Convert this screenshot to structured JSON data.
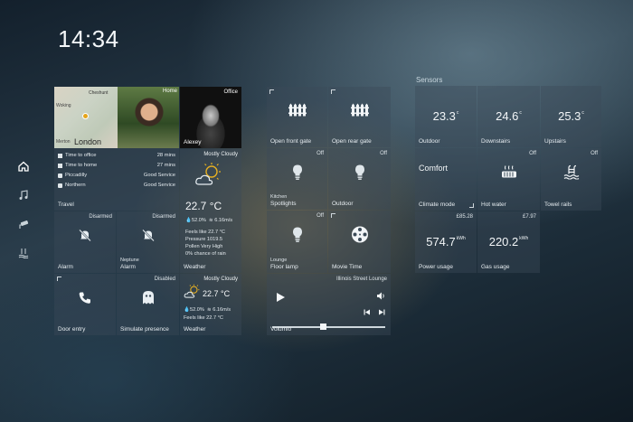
{
  "clock": "14:34",
  "nav": [
    "home-icon",
    "music-icon",
    "camera-icon",
    "water-icon"
  ],
  "travel": {
    "home_tag": "Home",
    "map_place": "London",
    "map_place2": "Cheshunt",
    "map_place3": "Merton",
    "map_place4": "Woking",
    "photo_tag": "Office",
    "photo_name": "Alexey",
    "rows": [
      {
        "label": "Time to office",
        "value": "28 mins"
      },
      {
        "label": "Time to home",
        "value": "27 mins"
      },
      {
        "label": "Piccadilly",
        "value": "Good Service"
      },
      {
        "label": "Northern",
        "value": "Good Service"
      }
    ],
    "label": "Travel"
  },
  "alarm1": {
    "state": "Disarmed",
    "label": "Alarm"
  },
  "alarm2": {
    "state": "Disarmed",
    "sub": "Neptune",
    "label": "Alarm"
  },
  "weather1": {
    "condition": "Mostly Cloudy",
    "temp": "22.7 °C",
    "humidity": "52.0%",
    "wind": "6.16m/s",
    "feels": "Feels like 22.7 °C",
    "pressure": "Pressure 1019.5",
    "pollen": "Pollen Very High",
    "rain": "0% chance of rain",
    "label": "Weather"
  },
  "door": {
    "label": "Door entry"
  },
  "presence": {
    "state": "Disabled",
    "label": "Simulate presence"
  },
  "weather2": {
    "condition": "Mostly Cloudy",
    "temp": "22.7 °C",
    "humidity": "52.0%",
    "wind": "6.16m/s",
    "feels": "Feels like 22.7 °C",
    "label": "Weather"
  },
  "gate_front": {
    "label": "Open front gate"
  },
  "gate_rear": {
    "label": "Open rear gate"
  },
  "spotlights": {
    "state": "Off",
    "sub": "Kitchen",
    "label": "Spotlights"
  },
  "outdoor_light": {
    "state": "Off",
    "label": "Outdoor"
  },
  "floor_lamp": {
    "state": "Off",
    "sub": "Lounge",
    "label": "Floor lamp"
  },
  "movie": {
    "label": "Movie Time"
  },
  "volumio": {
    "source": "Illinois Street Lounge",
    "label": "Volumio",
    "volume": 0.45
  },
  "sensors": {
    "title": "Sensors",
    "outdoor": {
      "value": "23.3",
      "unit": "c",
      "label": "Outdoor"
    },
    "downstairs": {
      "value": "24.6",
      "unit": "c",
      "label": "Downstairs"
    },
    "upstairs": {
      "value": "25.3",
      "unit": "c",
      "label": "Upstairs"
    },
    "climate": {
      "value": "Comfort",
      "label": "Climate mode"
    },
    "hot_water": {
      "state": "Off",
      "label": "Hot water"
    },
    "towel": {
      "state": "Off",
      "label": "Towel rails"
    },
    "power": {
      "price": "£85.28",
      "value": "574.7",
      "unit": "kWh",
      "label": "Power usage"
    },
    "gas": {
      "price": "£7.97",
      "value": "220.2",
      "unit": "kWh",
      "label": "Gas usage"
    }
  }
}
